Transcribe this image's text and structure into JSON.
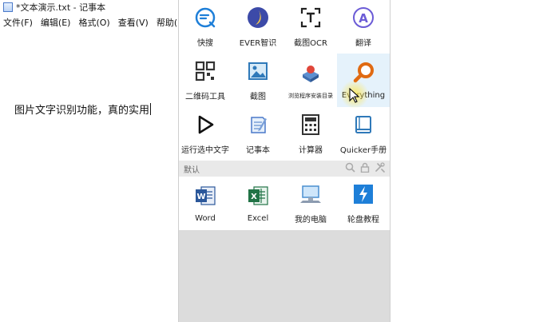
{
  "notepad": {
    "title": "*文本演示.txt - 记事本",
    "menu": [
      "文件(F)",
      "编辑(E)",
      "格式(O)",
      "查看(V)",
      "帮助(H)"
    ],
    "content": "图片文字识别功能，真的实用"
  },
  "quicker": {
    "top_items": [
      {
        "label": "快搜",
        "icon": "search-circle-icon"
      },
      {
        "label": "EVER智识",
        "icon": "ever-ai-icon"
      },
      {
        "label": "截图OCR",
        "icon": "screenshot-ocr-icon"
      },
      {
        "label": "翻译",
        "icon": "translate-icon"
      },
      {
        "label": "二维码工具",
        "icon": "qr-code-icon"
      },
      {
        "label": "截图",
        "icon": "image-icon"
      },
      {
        "label": "浏览程序安装目录",
        "icon": "browse-install-dir-icon"
      },
      {
        "label": "Everything",
        "icon": "everything-search-icon"
      },
      {
        "label": "运行选中文字",
        "icon": "play-icon"
      },
      {
        "label": "记事本",
        "icon": "notepad-icon"
      },
      {
        "label": "计算器",
        "icon": "calculator-icon"
      },
      {
        "label": "Quicker手册",
        "icon": "book-icon"
      }
    ],
    "section_label": "默认",
    "bottom_items": [
      {
        "label": "Word",
        "icon": "word-icon"
      },
      {
        "label": "Excel",
        "icon": "excel-icon"
      },
      {
        "label": "我的电脑",
        "icon": "computer-icon"
      },
      {
        "label": "轮盘教程",
        "icon": "lightning-icon"
      }
    ],
    "colors": {
      "accent": "#1e7fd8",
      "hover": "#e5f2fb",
      "everything": "#e06a12",
      "word": "#2b579a",
      "excel": "#217346"
    }
  }
}
